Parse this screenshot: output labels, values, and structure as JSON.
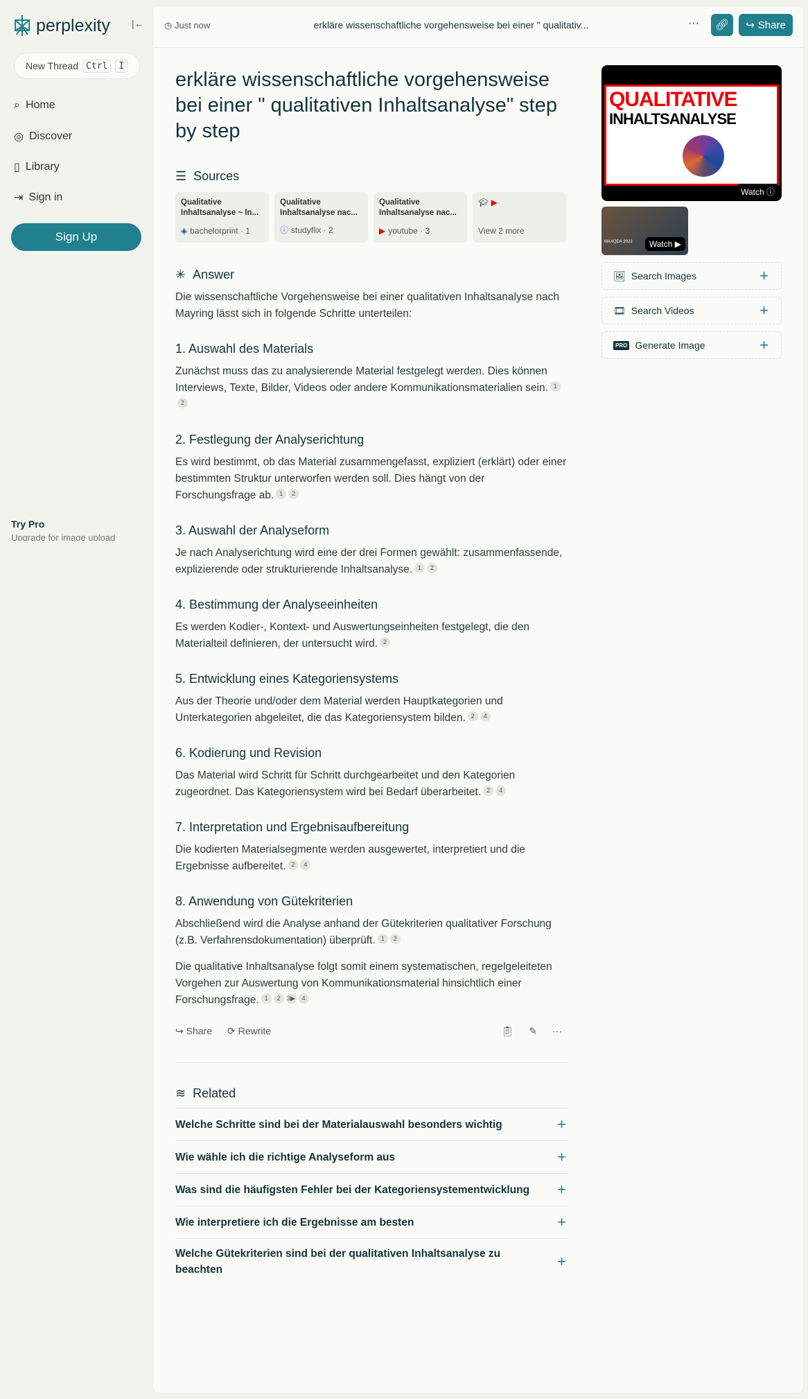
{
  "sidebar": {
    "brand": "perplexity",
    "new_thread": "New Thread",
    "kbd1": "Ctrl",
    "kbd2": "I",
    "nav": [
      {
        "label": "Home",
        "icon": "search-icon"
      },
      {
        "label": "Discover",
        "icon": "compass-icon"
      },
      {
        "label": "Library",
        "icon": "library-icon"
      },
      {
        "label": "Sign in",
        "icon": "sign-in-icon"
      }
    ],
    "signup": "Sign Up",
    "try_pro": "Try Pro",
    "upgrade": "Upgrade for image upload"
  },
  "header": {
    "time": "Just now",
    "title": "erkläre wissenschaftliche vorgehensweise bei einer \" qualitativ...",
    "share": "Share"
  },
  "query": "erkläre wissenschaftliche vorgehensweise bei einer \" qualitativen Inhaltsanalyse\" step by step",
  "sources": {
    "heading": "Sources",
    "items": [
      {
        "title1": "Qualitative",
        "title2": "Inhaltsanalyse ~ In...",
        "site": "bachelorprint · 1"
      },
      {
        "title1": "Qualitative",
        "title2": "Inhaltsanalyse nac...",
        "site": "studyflix · 2"
      },
      {
        "title1": "Qualitative",
        "title2": "Inhaltsanalyse nac...",
        "site": "youtube · 3"
      }
    ],
    "more": "View 2 more"
  },
  "answer": {
    "heading": "Answer",
    "intro": "Die wissenschaftliche Vorgehensweise bei einer qualitativen Inhaltsanalyse nach Mayring lässt sich in folgende Schritte unterteilen:",
    "steps": [
      {
        "h": "1. Auswahl des Materials",
        "p": "Zunächst muss das zu analysierende Material festgelegt werden. Dies können Interviews, Texte, Bilder, Videos oder andere Kommunikationsmaterialien sein.",
        "c": [
          "1",
          "2"
        ]
      },
      {
        "h": "2. Festlegung der Analyserichtung",
        "p": "Es wird bestimmt, ob das Material zusammengefasst, expliziert (erklärt) oder einer bestimmten Struktur unterworfen werden soll. Dies hängt von der Forschungsfrage ab.",
        "c": [
          "1",
          "2"
        ]
      },
      {
        "h": "3. Auswahl der Analyseform",
        "p": "Je nach Analyserichtung wird eine der drei Formen gewählt: zusammenfassende, explizierende oder strukturierende Inhaltsanalyse.",
        "c": [
          "1",
          "2"
        ]
      },
      {
        "h": "4. Bestimmung der Analyseeinheiten",
        "p": "Es werden Kodier-, Kontext- und Auswertungseinheiten festgelegt, die den Materialteil definieren, der untersucht wird.",
        "c": [
          "2"
        ]
      },
      {
        "h": "5. Entwicklung eines Kategoriensystems",
        "p": "Aus der Theorie und/oder dem Material werden Hauptkategorien und Unterkategorien abgeleitet, die das Kategoriensystem bilden.",
        "c": [
          "2",
          "4"
        ]
      },
      {
        "h": "6. Kodierung und Revision",
        "p": "Das Material wird Schritt für Schritt durchgearbeitet und den Kategorien zugeordnet. Das Kategoriensystem wird bei Bedarf überarbeitet.",
        "c": [
          "2",
          "4"
        ]
      },
      {
        "h": "7. Interpretation und Ergebnisaufbereitung",
        "p": "Die kodierten Materialsegmente werden ausgewertet, interpretiert und die Ergebnisse aufbereitet.",
        "c": [
          "2",
          "4"
        ]
      },
      {
        "h": "8. Anwendung von Gütekriterien",
        "p": "Abschließend wird die Analyse anhand der Gütekriterien qualitativer Forschung (z.B. Verfahrensdokumentation) überprüft.",
        "c": [
          "1",
          "2"
        ]
      }
    ],
    "conclusion": "Die qualitative Inhaltsanalyse folgt somit einem systematischen, regelgeleiteten Vorgehen zur Auswertung von Kommunikationsmaterial hinsichtlich einer Forschungsfrage.",
    "conclusion_cites": [
      "1",
      "2",
      "3▶",
      "4"
    ],
    "share": "Share",
    "rewrite": "Rewrite"
  },
  "related": {
    "heading": "Related",
    "items": [
      "Welche Schritte sind bei der Materialauswahl besonders wichtig",
      "Wie wähle ich die richtige Analyseform aus",
      "Was sind die häufigsten Fehler bei der Kategoriensystementwicklung",
      "Wie interpretiere ich die Ergebnisse am besten",
      "Welche Gütekriterien sind bei der qualitativen Inhaltsanalyse zu beachten"
    ]
  },
  "right": {
    "video1": {
      "title1": "QUALITATIVE",
      "title2": "INHALTSANALYSE",
      "watch": "Watch"
    },
    "video2": {
      "caption": "MAXQDA 2022",
      "watch": "Watch"
    },
    "actions": [
      "Search Images",
      "Search Videos",
      "Generate Image"
    ],
    "pro_badge": "PRO"
  },
  "colors": {
    "accent": "#20808d",
    "text": "#13343b"
  }
}
